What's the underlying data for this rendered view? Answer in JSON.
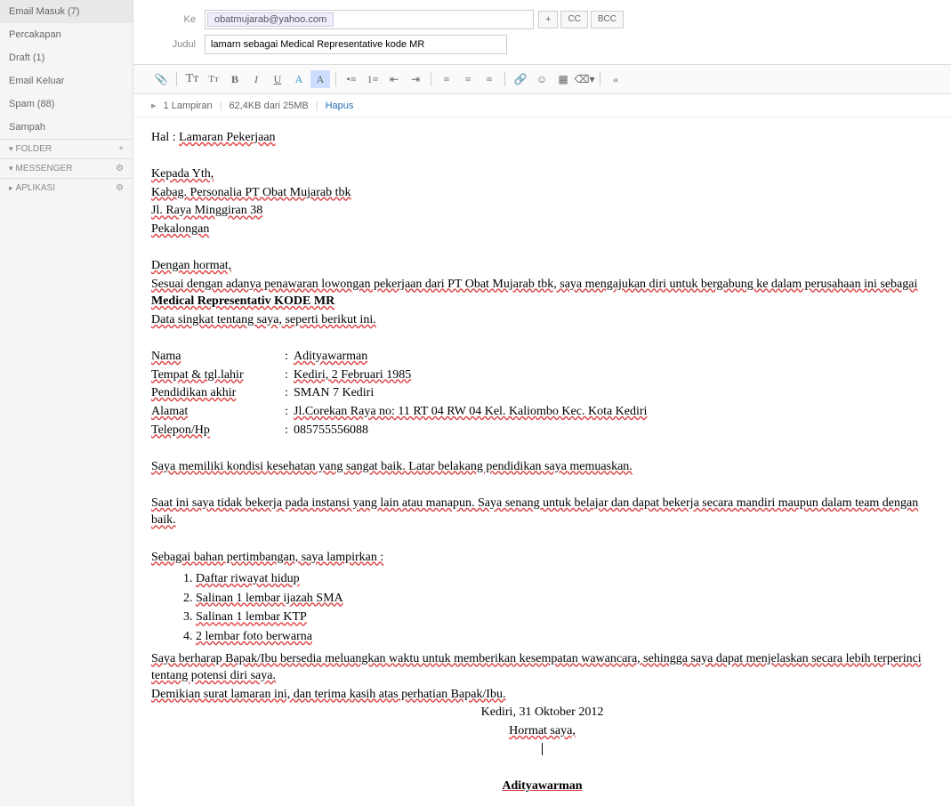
{
  "sidebar": {
    "items": [
      {
        "label": "Email Masuk (7)"
      },
      {
        "label": "Percakapan"
      },
      {
        "label": "Draft (1)"
      },
      {
        "label": "Email Keluar"
      },
      {
        "label": "Spam (88)"
      },
      {
        "label": "Sampah"
      }
    ],
    "sections": [
      {
        "label": "FOLDER",
        "icon": "+"
      },
      {
        "label": "MESSENGER",
        "icon": "⚙"
      },
      {
        "label": "APLIKASI",
        "icon": "⚙"
      }
    ]
  },
  "compose": {
    "to_label": "Ke",
    "to_value": "obatmujarab@yahoo.com",
    "plus": "+",
    "cc": "CC",
    "bcc": "BCC",
    "subject_label": "Judul",
    "subject_value": "lamarn sebagai Medical Representative kode MR"
  },
  "attachments": {
    "count": "1 Lampiran",
    "size": "62,4KB dari 25MB",
    "remove": "Hapus"
  },
  "letter": {
    "hal_label": "Hal : ",
    "hal": "Lamaran Pekerjaan",
    "kepada": "Kepada Yth,",
    "line1": "Kabag. Personalia PT Obat Mujarab tbk",
    "line2": "Jl. Raya Minggiran 38",
    "line3": "Pekalongan",
    "hormat": "Dengan hormat,",
    "p1a": "Sesuai dengan adanya penawaran lowongan pekerjaan dari PT Obat Mujarab tbk, saya mengajukan diri untuk bergabung ke dalam perusahaan ini sebagai ",
    "p1b": "Medical Representativ KODE MR",
    "p2": "Data singkat tentang saya, seperti berikut ini.",
    "bio": {
      "nama_l": "Nama",
      "nama_v": "Adityawarman",
      "ttl_l": "Tempat & tgl.lahir",
      "ttl_v": "Kediri, 2 Februari 1985",
      "pend_l": "Pendidikan akhir",
      "pend_v": "SMAN 7 Kediri",
      "alamat_l": "Alamat",
      "alamat_v": "Jl.Corekan Raya no: 11 RT 04 RW 04 Kel. Kaliombo Kec. Kota Kediri",
      "telp_l": "Telepon/Hp",
      "telp_v": "085755556088"
    },
    "p3": "Saya memiliki kondisi kesehatan yang sangat baik. Latar belakang pendidikan saya memuaskan.",
    "p4": "Saat ini saya tidak bekerja pada instansi yang lain atau manapun. Saya senang untuk belajar dan dapat bekerja secara mandiri maupun dalam team dengan baik.",
    "p5": "Sebagai bahan pertimbangan, saya lampirkan :",
    "list": [
      "Daftar riwayat hidup",
      "Salinan 1 lembar ijazah SMA",
      "Salinan 1 lembar KTP",
      "2 lembar foto berwarna"
    ],
    "p6": "Saya berharap Bapak/Ibu bersedia meluangkan waktu untuk memberikan kesempatan wawancara, sehingga saya dapat menjelaskan secara lebih terperinci tentang potensi diri saya.",
    "p7": "Demikian surat lamaran ini, dan terima kasih atas perhatian Bapak/Ibu.",
    "date": "Kediri, 31 Oktober 2012",
    "closing": "Hormat saya,",
    "sign": "Adityawarman"
  }
}
